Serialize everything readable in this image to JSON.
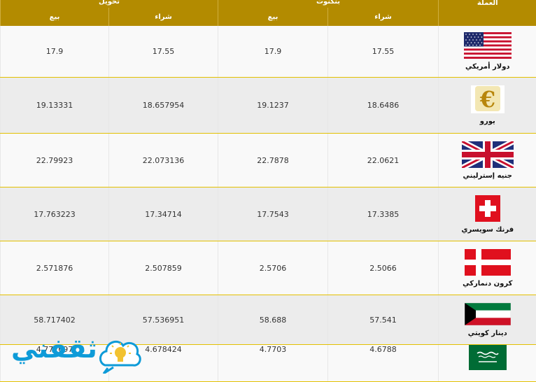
{
  "header": {
    "currency": "العملة",
    "group_transfer": "تحويل",
    "group_banknotes": "بنكنوت",
    "buy": "شراء",
    "sell": "بيع"
  },
  "rows": [
    {
      "name": "دولار أمريكي",
      "flag_icon": "usa-flag-icon",
      "banknote_buy": "17.55",
      "banknote_sell": "17.9",
      "transfer_buy": "17.55",
      "transfer_sell": "17.9"
    },
    {
      "name": "يورو",
      "flag_icon": "euro-symbol-icon",
      "banknote_buy": "18.6486",
      "banknote_sell": "19.1237",
      "transfer_buy": "18.657954",
      "transfer_sell": "19.13331"
    },
    {
      "name": "جنيه إسترليني",
      "flag_icon": "uk-flag-icon",
      "banknote_buy": "22.0621",
      "banknote_sell": "22.7878",
      "transfer_buy": "22.073136",
      "transfer_sell": "22.79923"
    },
    {
      "name": "فرنك سويسري",
      "flag_icon": "swiss-flag-icon",
      "banknote_buy": "17.3385",
      "banknote_sell": "17.7543",
      "transfer_buy": "17.34714",
      "transfer_sell": "17.763223"
    },
    {
      "name": "كرون دنماركي",
      "flag_icon": "denmark-flag-icon",
      "banknote_buy": "2.5066",
      "banknote_sell": "2.5706",
      "transfer_buy": "2.507859",
      "transfer_sell": "2.571876"
    },
    {
      "name": "دينار كويتي",
      "flag_icon": "kuwait-flag-icon",
      "banknote_buy": "57.541",
      "banknote_sell": "58.688",
      "transfer_buy": "57.536951",
      "transfer_sell": "58.717402"
    },
    {
      "name": "",
      "flag_icon": "saudi-flag-icon",
      "banknote_buy": "4.6788",
      "banknote_sell": "4.7703",
      "transfer_buy": "4.678424",
      "transfer_sell": "4.772697"
    }
  ],
  "logo": {
    "text": "ثقفني",
    "icon": "lightbulb-icon"
  },
  "colors": {
    "header_bg": "#b38b00",
    "row_border": "#e3c000",
    "logo_blue": "#0e9bd8"
  }
}
